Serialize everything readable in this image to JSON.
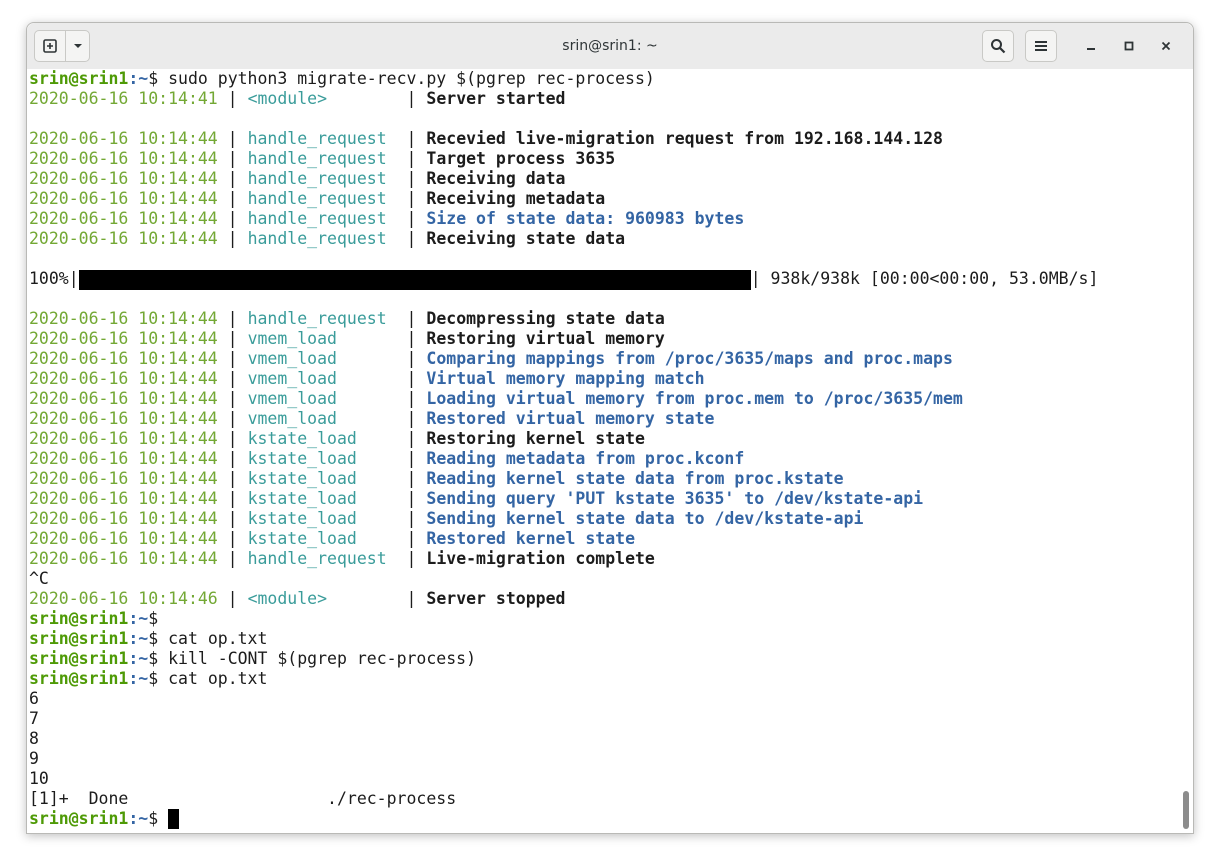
{
  "window": {
    "title": "srin@srin1: ~"
  },
  "terminal": {
    "prompt_user_host": "srin@srin1",
    "prompt_suffix": ":~$",
    "cmd1": " sudo python3 migrate-recv.py $(pgrep rec-process)",
    "log1": [
      {
        "ts": "2020-06-16 10:14:41",
        "fn": "<module>       ",
        "msg": "Server started",
        "style": "bold"
      }
    ],
    "log2": [
      {
        "ts": "2020-06-16 10:14:44",
        "fn": "handle_request ",
        "msg": "Recevied live-migration request from 192.168.144.128",
        "style": "bold"
      },
      {
        "ts": "2020-06-16 10:14:44",
        "fn": "handle_request ",
        "msg": "Target process 3635",
        "style": "bold"
      },
      {
        "ts": "2020-06-16 10:14:44",
        "fn": "handle_request ",
        "msg": "Receiving data",
        "style": "bold"
      },
      {
        "ts": "2020-06-16 10:14:44",
        "fn": "handle_request ",
        "msg": "Receiving metadata",
        "style": "bold"
      },
      {
        "ts": "2020-06-16 10:14:44",
        "fn": "handle_request ",
        "msg": "Size of state data: 960983 bytes",
        "style": "blue"
      },
      {
        "ts": "2020-06-16 10:14:44",
        "fn": "handle_request ",
        "msg": "Receiving state data",
        "style": "bold"
      }
    ],
    "progress": {
      "percent_label": "100%",
      "fraction": 1.0,
      "stats": " 938k/938k [00:00<00:00, 53.0MB/s]"
    },
    "log3": [
      {
        "ts": "2020-06-16 10:14:44",
        "fn": "handle_request ",
        "msg": "Decompressing state data",
        "style": "bold"
      },
      {
        "ts": "2020-06-16 10:14:44",
        "fn": "vmem_load      ",
        "msg": "Restoring virtual memory",
        "style": "bold"
      },
      {
        "ts": "2020-06-16 10:14:44",
        "fn": "vmem_load      ",
        "msg": "Comparing mappings from /proc/3635/maps and proc.maps",
        "style": "blue"
      },
      {
        "ts": "2020-06-16 10:14:44",
        "fn": "vmem_load      ",
        "msg": "Virtual memory mapping match",
        "style": "blue"
      },
      {
        "ts": "2020-06-16 10:14:44",
        "fn": "vmem_load      ",
        "msg": "Loading virtual memory from proc.mem to /proc/3635/mem",
        "style": "blue"
      },
      {
        "ts": "2020-06-16 10:14:44",
        "fn": "vmem_load      ",
        "msg": "Restored virtual memory state",
        "style": "blue"
      },
      {
        "ts": "2020-06-16 10:14:44",
        "fn": "kstate_load    ",
        "msg": "Restoring kernel state",
        "style": "bold"
      },
      {
        "ts": "2020-06-16 10:14:44",
        "fn": "kstate_load    ",
        "msg": "Reading metadata from proc.kconf",
        "style": "blue"
      },
      {
        "ts": "2020-06-16 10:14:44",
        "fn": "kstate_load    ",
        "msg": "Reading kernel state data from proc.kstate",
        "style": "blue"
      },
      {
        "ts": "2020-06-16 10:14:44",
        "fn": "kstate_load    ",
        "msg": "Sending query 'PUT kstate 3635' to /dev/kstate-api",
        "style": "blue"
      },
      {
        "ts": "2020-06-16 10:14:44",
        "fn": "kstate_load    ",
        "msg": "Sending kernel state data to /dev/kstate-api",
        "style": "blue"
      },
      {
        "ts": "2020-06-16 10:14:44",
        "fn": "kstate_load    ",
        "msg": "Restored kernel state",
        "style": "blue"
      },
      {
        "ts": "2020-06-16 10:14:44",
        "fn": "handle_request ",
        "msg": "Live-migration complete",
        "style": "bold"
      }
    ],
    "interrupt": "^C",
    "log4": [
      {
        "ts": "2020-06-16 10:14:46",
        "fn": "<module>       ",
        "msg": "Server stopped",
        "style": "bold"
      }
    ],
    "cmd2": "",
    "cmd3": " cat op.txt",
    "cmd4": " kill -CONT $(pgrep rec-process)",
    "cmd5": " cat op.txt",
    "output": [
      "6",
      "7",
      "8",
      "9",
      "10"
    ],
    "job_done": "[1]+  Done                    ./rec-process",
    "cmd6": " "
  }
}
